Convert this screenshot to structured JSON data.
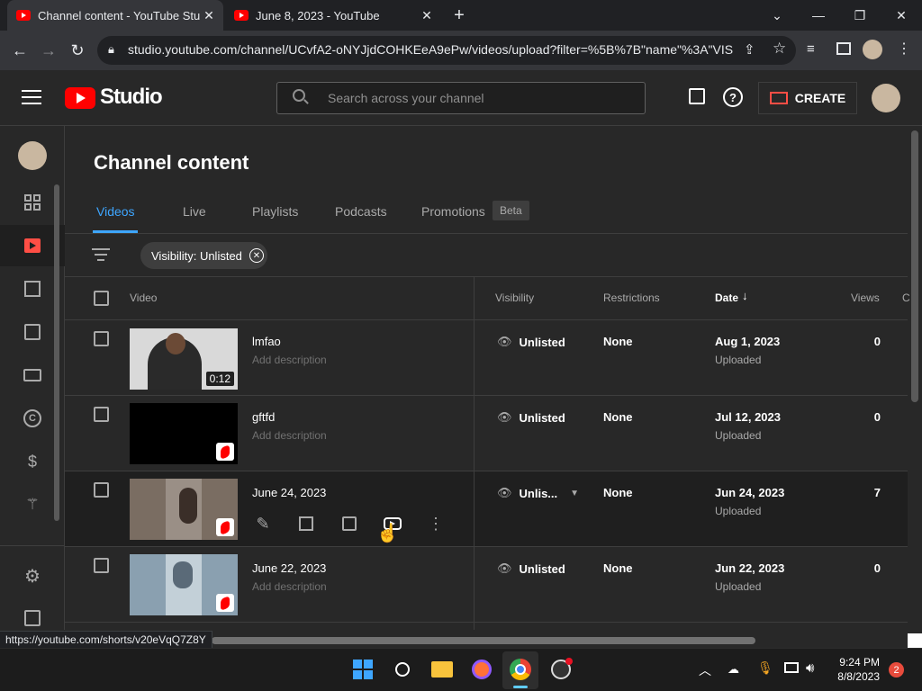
{
  "browser": {
    "tabs": [
      {
        "title": "Channel content - YouTube Studio",
        "active": true
      },
      {
        "title": "June 8, 2023 - YouTube",
        "active": false
      }
    ],
    "url": "studio.youtube.com/channel/UCvfA2-oNYJjdCOHKEeA9ePw/videos/upload?filter=%5B%7B\"name\"%3A\"VIS...",
    "status_url": "https://youtube.com/shorts/v20eVqQ7Z8Y"
  },
  "header": {
    "logo_text": "Studio",
    "search_placeholder": "Search across your channel",
    "create_label": "CREATE"
  },
  "page": {
    "title": "Channel content",
    "tabs": [
      {
        "label": "Videos",
        "active": true
      },
      {
        "label": "Live",
        "active": false
      },
      {
        "label": "Playlists",
        "active": false
      },
      {
        "label": "Podcasts",
        "active": false
      },
      {
        "label": "Promotions",
        "active": false
      }
    ],
    "beta_badge": "Beta",
    "filter_chip": "Visibility: Unlisted",
    "columns": {
      "video": "Video",
      "visibility": "Visibility",
      "restrictions": "Restrictions",
      "date": "Date",
      "views": "Views",
      "comments": "C"
    }
  },
  "videos": [
    {
      "title": "lmfao",
      "description": "Add description",
      "visibility": "Unlisted",
      "restrictions": "None",
      "date": "Aug 1, 2023",
      "status": "Uploaded",
      "views": "0",
      "duration": "0:12",
      "is_short": false
    },
    {
      "title": "gftfd",
      "description": "Add description",
      "visibility": "Unlisted",
      "restrictions": "None",
      "date": "Jul 12, 2023",
      "status": "Uploaded",
      "views": "0",
      "is_short": true
    },
    {
      "title": "June 24, 2023",
      "description": "",
      "visibility": "Unlis...",
      "restrictions": "None",
      "date": "Jun 24, 2023",
      "status": "Uploaded",
      "views": "7",
      "is_short": true,
      "hovered": true
    },
    {
      "title": "June 22, 2023",
      "description": "Add description",
      "visibility": "Unlisted",
      "restrictions": "None",
      "date": "Jun 22, 2023",
      "status": "Uploaded",
      "views": "0",
      "is_short": true
    }
  ],
  "taskbar": {
    "time": "9:24 PM",
    "date": "8/8/2023",
    "notifications": "2"
  },
  "colors": {
    "accent_blue": "#3ea6ff",
    "youtube_red": "#ff0000",
    "background": "#282828"
  }
}
